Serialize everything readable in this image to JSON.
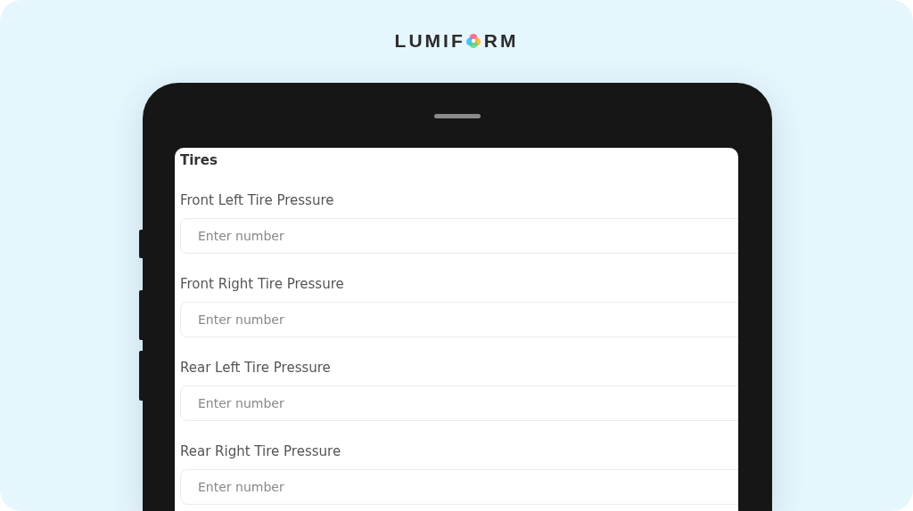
{
  "logo": {
    "before": "LUMIF",
    "after": "RM"
  },
  "section": {
    "title": "Tires"
  },
  "fields": [
    {
      "label": "Front Left Tire Pressure",
      "placeholder": "Enter number"
    },
    {
      "label": "Front Right Tire Pressure",
      "placeholder": "Enter number"
    },
    {
      "label": "Rear Left Tire Pressure",
      "placeholder": "Enter number"
    },
    {
      "label": "Rear Right Tire Pressure",
      "placeholder": "Enter number"
    }
  ]
}
